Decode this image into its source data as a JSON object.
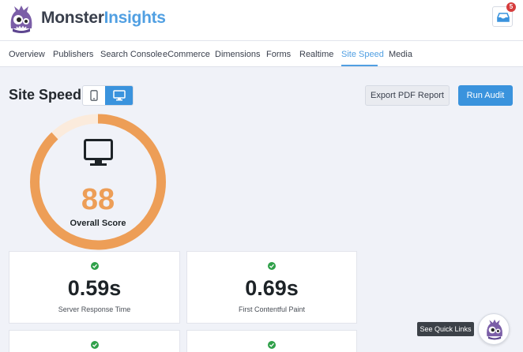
{
  "brand": {
    "name_part1": "Monster",
    "name_part2": "Insights",
    "logo_icon": "monster-mascot-icon",
    "color_primary": "#509fe2",
    "color_dark": "#393f4c"
  },
  "header": {
    "inbox_icon": "inbox-icon",
    "notification_count": "5"
  },
  "nav": {
    "tabs": [
      {
        "label": "Overview"
      },
      {
        "label": "Publishers"
      },
      {
        "label": "Search Console"
      },
      {
        "label": "eCommerce"
      },
      {
        "label": "Dimensions"
      },
      {
        "label": "Forms"
      },
      {
        "label": "Realtime"
      },
      {
        "label": "Site Speed",
        "active": true
      },
      {
        "label": "Media"
      }
    ]
  },
  "page": {
    "title": "Site Speed",
    "device_toggle": {
      "options": [
        "mobile-icon",
        "desktop-icon"
      ],
      "selected": "desktop"
    },
    "export_label": "Export PDF Report",
    "audit_label": "Run Audit"
  },
  "score": {
    "value": "88",
    "percent": 88,
    "label": "Overall Score",
    "icon": "monitor-icon",
    "color": "#ed9e57",
    "track_color": "#fbebdc"
  },
  "metrics": [
    {
      "value": "0.59s",
      "label": "Server Response Time",
      "status": "good"
    },
    {
      "value": "0.69s",
      "label": "First Contentful Paint",
      "status": "good"
    },
    {
      "value": "",
      "label": "",
      "status": "good"
    },
    {
      "value": "",
      "label": "",
      "status": "good"
    }
  ],
  "quick_links": {
    "label": "See Quick Links",
    "icon": "monster-mascot-icon"
  },
  "colors": {
    "accent": "#3a93dd",
    "success": "#2fa049",
    "badge": "#d63c3c"
  }
}
